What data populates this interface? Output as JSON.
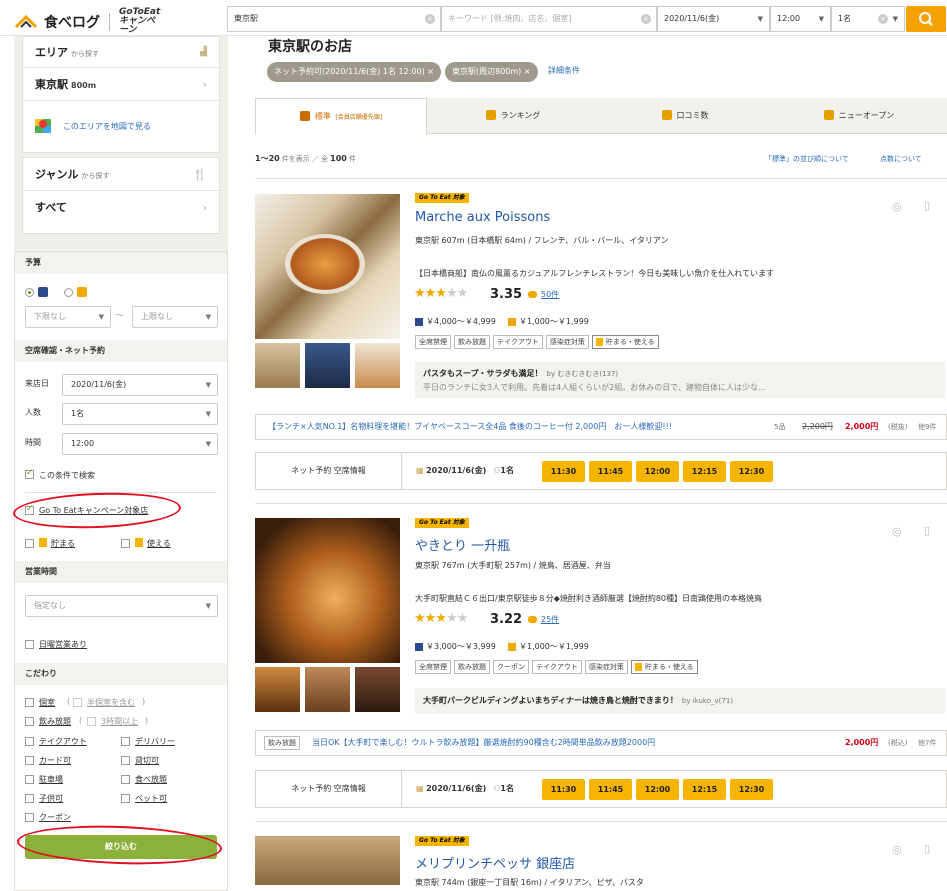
{
  "header": {
    "logo_text": "食べログ",
    "campaign_logo": "GoToEat キャンペーン",
    "area_value": "東京駅",
    "keyword_placeholder": "キーワード [例:焼肉、店名、個室]",
    "date_value": "2020/11/6(金)",
    "time_value": "12:00",
    "people_value": "1名",
    "search_icon": "search-icon"
  },
  "sidebar": {
    "area_title": "エリア",
    "area_sub": "から探す",
    "station": "東京駅",
    "station_dist": "800m",
    "map_link": "このエリアを地図で見る",
    "genre_title": "ジャンル",
    "genre_sub": "から探す",
    "genre_all": "すべて",
    "budget_title": "予算",
    "budget_min": "下限なし",
    "budget_max": "上限なし",
    "budget_sep": "〜",
    "avail_title": "空席確認・ネット予約",
    "visit_date_label": "来店日",
    "visit_date": "2020/11/6(金)",
    "people_label": "人数",
    "people": "1名",
    "time_label": "時間",
    "time": "12:00",
    "cond_search": "この条件で検索",
    "gotoeat_label": "Go To Eatキャンペーン対象店",
    "tamaru": "貯まる",
    "tsukaeru": "使える",
    "hours_title": "営業時間",
    "hours_placeholder": "指定なし",
    "dailyopen": "日曜営業あり",
    "pref_title": "こだわり",
    "private_room": "個室",
    "semi_private": "半個室を含む",
    "nomihoudai": "飲み放題",
    "over3h": "3時間以上",
    "takeout": "テイクアウト",
    "delivery": "デリバリー",
    "card": "カード可",
    "kashikiri": "貸切可",
    "parking": "駐車場",
    "tabehoudai": "食べ放題",
    "kids": "子供可",
    "pets": "ペット可",
    "coupon": "クーポン",
    "narrow_button": "絞り込む"
  },
  "main": {
    "page_title": "東京駅のお店",
    "tags": [
      "ネット予約可(2020/11/6(金) 1名 12:00) ×",
      "東京駅(周辺800m) ×"
    ],
    "detail_link": "詳細条件",
    "tabs": [
      {
        "label": "標準",
        "sub": "[会員店舗優先順]"
      },
      {
        "label": "ランキング",
        "sub": ""
      },
      {
        "label": "口コミ数",
        "sub": ""
      },
      {
        "label": "ニューオープン",
        "sub": ""
      }
    ],
    "count_range": "1〜20",
    "count_mid": "件を表示 ／ 全",
    "count_total": "100",
    "count_end": "件",
    "sort_link": "「標準」の並び順について",
    "score_link": "点数について",
    "gotoeat_badge": "Go To Eat 対象",
    "net_reserve_label": "ネット予約 空席情報",
    "reserve_date": "2020/11/6(金)",
    "reserve_people": "1名"
  },
  "restaurants": [
    {
      "name": "Marche aux Poissons",
      "info": "東京駅 607m (日本橋駅 64m) / フレンチ、バル・バール、イタリアン",
      "desc": "【日本橋商船】南仏の風薫るカジュアルフレンチレストラン！今日も美味しい魚介を仕入れています",
      "score": "3.35",
      "stars": 3,
      "reviews": "50件",
      "dinner_price": "￥4,000〜￥4,999",
      "lunch_price": "￥1,000〜￥1,999",
      "chips": [
        "全席禁煙",
        "飲み放題",
        "テイクアウト",
        "感染症対策",
        "貯まる・使える"
      ],
      "review_title": "パスタもスープ・サラダも満足！",
      "review_by": "by むきむきむき(137)",
      "review_body": "平日のランチに女3人で利用。先着は4人組くらいが2組。お休みの日で、建物自体に人は少な...",
      "promo_text": "【ランチ×人気NO.1】名物料理を堪能！ブイヤベースコース全4品 食後のコーヒー付 2,000円　お一人様歓迎!!!",
      "promo_items": "5品",
      "promo_old": "2,200円",
      "promo_new": "2,000円",
      "promo_tax": "(税抜)",
      "promo_more": "他9件",
      "slots": [
        "11:30",
        "11:45",
        "12:00",
        "12:15",
        "12:30"
      ]
    },
    {
      "name": "やきとり 一升瓶",
      "info": "東京駅 767m (大手町駅 257m) / 焼鳥、居酒屋、弁当",
      "desc": "大手町駅直結Ｃ６出口/東京駅徒歩８分◆焼酎利き酒師厳選【焼酎約80種】日南鶏使用の本格焼鳥",
      "score": "3.22",
      "stars": 3,
      "reviews": "25件",
      "dinner_price": "￥3,000〜￥3,999",
      "lunch_price": "￥1,000〜￥1,999",
      "chips": [
        "全席禁煙",
        "飲み放題",
        "クーポン",
        "テイクアウト",
        "感染症対策",
        "貯まる・使える"
      ],
      "review_title": "大手町パークビルディングよいまちディナーは焼き鳥と焼酎できまり！",
      "review_by": "by ikuko_v(71)",
      "promo_tag": "飲み放題",
      "promo_text": "当日OK【大手町で楽しむ！ウルトラ飲み放題】厳選焼酎約90種含む2時間単品飲み放題2000円",
      "promo_new": "2,000円",
      "promo_tax": "(税込)",
      "promo_more": "他7件",
      "slots": [
        "11:30",
        "11:45",
        "12:00",
        "12:15",
        "12:30"
      ]
    },
    {
      "name": "メリプリンチペッサ 銀座店",
      "info": "東京駅 744m (銀座一丁目駅 16m) / イタリアン、ピザ、パスタ"
    }
  ],
  "colors": {
    "accent": "#f5b400",
    "link": "#2358a8",
    "annotation": "#e01020"
  }
}
